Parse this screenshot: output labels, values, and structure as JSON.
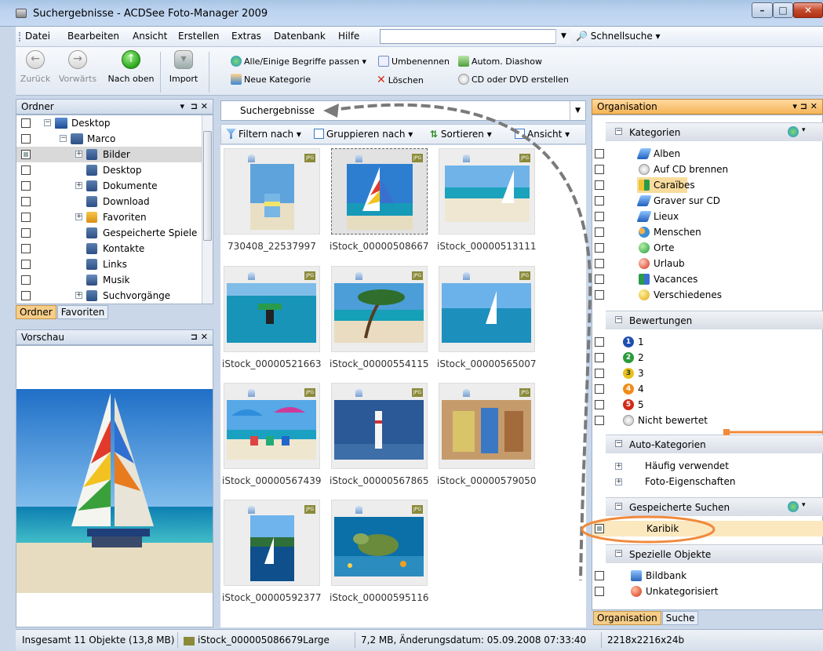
{
  "window": {
    "title": "Suchergebnisse - ACDSee Foto-Manager 2009"
  },
  "menu": {
    "items": [
      "Datei",
      "Bearbeiten",
      "Ansicht",
      "Erstellen",
      "Extras",
      "Datenbank",
      "Hilfe"
    ],
    "quick_search": "Schnellsuche"
  },
  "toolbar": {
    "back": "Zurück",
    "forward": "Vorwärts",
    "up": "Nach oben",
    "import": "Import",
    "match_terms": "Alle/Einige Begriffe passen",
    "rename": "Umbenennen",
    "slideshow": "Autom. Diashow",
    "new_category": "Neue Kategorie",
    "delete": "Löschen",
    "burn": "CD oder DVD erstellen"
  },
  "folders": {
    "title": "Ordner",
    "items": [
      "Desktop",
      "Marco",
      "Bilder",
      "Desktop",
      "Dokumente",
      "Download",
      "Favoriten",
      "Gespeicherte Spiele",
      "Kontakte",
      "Links",
      "Musik",
      "Suchvorgänge"
    ],
    "tabs": [
      "Ordner",
      "Favoriten"
    ]
  },
  "preview": {
    "title": "Vorschau"
  },
  "center": {
    "breadcrumb": "Suchergebnisse",
    "filter": "Filtern nach",
    "group": "Gruppieren nach",
    "sort": "Sortieren",
    "view": "Ansicht",
    "thumbs": [
      "730408_22537997",
      "iStock_00000508667...",
      "iStock_00000513111...",
      "iStock_00000521663...",
      "iStock_00000554115...",
      "iStock_00000565007...",
      "iStock_00000567439...",
      "iStock_00000567865...",
      "iStock_00000579050...",
      "iStock_00000592377...",
      "iStock_00000595116..."
    ]
  },
  "organisation": {
    "title": "Organisation",
    "categories_title": "Kategorien",
    "categories": [
      "Alben",
      "Auf CD brennen",
      "Caraïbes",
      "Graver sur CD",
      "Lieux",
      "Menschen",
      "Orte",
      "Urlaub",
      "Vacances",
      "Verschiedenes"
    ],
    "ratings_title": "Bewertungen",
    "ratings": [
      "1",
      "2",
      "3",
      "4",
      "5",
      "Nicht bewertet"
    ],
    "auto_title": "Auto-Kategorien",
    "auto": [
      "Häufig verwendet",
      "Foto-Eigenschaften"
    ],
    "saved_title": "Gespeicherte Suchen",
    "saved": [
      "Karibik"
    ],
    "special_title": "Spezielle Objekte",
    "special": [
      "Bildbank",
      "Unkategorisiert"
    ],
    "tabs": [
      "Organisation",
      "Suche"
    ]
  },
  "status": {
    "total": "Insgesamt 11 Objekte  (13,8 MB)",
    "file": "iStock_000005086679Large",
    "info": "7,2 MB, Änderungsdatum: 05.09.2008 07:33:40",
    "dims": "2218x2216x24b"
  }
}
